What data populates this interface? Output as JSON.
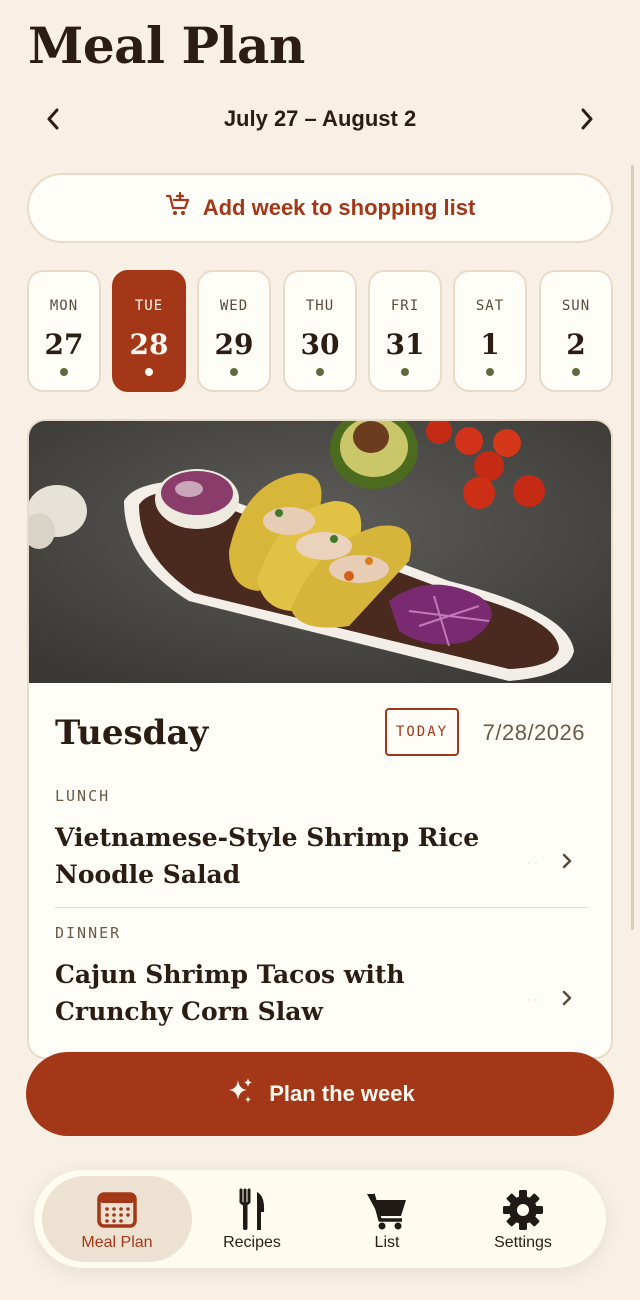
{
  "header": {
    "title": "Meal Plan"
  },
  "week": {
    "range": "July 27 – August 2",
    "prev_icon": "chevron-left-icon",
    "next_icon": "chevron-right-icon"
  },
  "add_week": {
    "label": "Add week to shopping list",
    "icon": "cart-plus-icon"
  },
  "days": [
    {
      "name": "MON",
      "num": "27",
      "active": false
    },
    {
      "name": "TUE",
      "num": "28",
      "active": true
    },
    {
      "name": "WED",
      "num": "29",
      "active": false
    },
    {
      "name": "THU",
      "num": "30",
      "active": false
    },
    {
      "name": "FRI",
      "num": "31",
      "active": false
    },
    {
      "name": "SAT",
      "num": "1",
      "active": false
    },
    {
      "name": "SUN",
      "num": "2",
      "active": false
    }
  ],
  "day_card": {
    "heading": "Tuesday",
    "badge": "TODAY",
    "date": "7/28/2026",
    "meals": [
      {
        "label": "LUNCH",
        "title": "Vietnamese-Style Shrimp Rice Noodle Salad"
      },
      {
        "label": "DINNER",
        "title": "Cajun Shrimp Tacos with Crunchy Corn Slaw"
      }
    ]
  },
  "plan_button": {
    "label": "Plan the week",
    "icon": "sparkles-icon"
  },
  "tabs": [
    {
      "label": "Meal Plan",
      "icon": "calendar-icon",
      "active": true
    },
    {
      "label": "Recipes",
      "icon": "fork-knife-icon",
      "active": false
    },
    {
      "label": "List",
      "icon": "cart-icon",
      "active": false
    },
    {
      "label": "Settings",
      "icon": "gear-icon",
      "active": false
    }
  ],
  "colors": {
    "accent": "#a33718",
    "background": "#f8f0e5",
    "card": "#fffdf8",
    "dot": "#5f6b3c"
  }
}
